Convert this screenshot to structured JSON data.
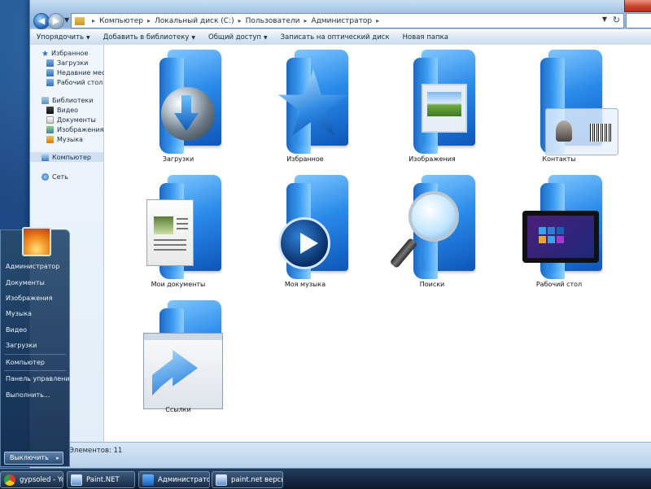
{
  "window": {
    "breadcrumbs": [
      "Компьютер",
      "Локальный диск (C:)",
      "Пользователи",
      "Администратор"
    ]
  },
  "toolbar": {
    "organize": "Упорядочить",
    "add_to_library": "Добавить в библиотеку",
    "share": "Общий доступ",
    "burn": "Записать на оптический диск",
    "new_folder": "Новая папка"
  },
  "navpane": {
    "favorites": "Избранное",
    "downloads": "Загрузки",
    "recent": "Недавние места",
    "desktop": "Рабочий стол",
    "libraries": "Библиотеки",
    "video": "Видео",
    "documents": "Документы",
    "images": "Изображения",
    "music": "Музыка",
    "computer": "Компьютер",
    "network": "Сеть"
  },
  "items": [
    {
      "label": "Загрузки",
      "icon": "download-globe-icon"
    },
    {
      "label": "Избранное",
      "icon": "star-icon"
    },
    {
      "label": "Изображения",
      "icon": "picture-icon"
    },
    {
      "label": "Контакты",
      "icon": "contact-card-icon"
    },
    {
      "label": "Мои документы",
      "icon": "document-icon"
    },
    {
      "label": "Моя музыка",
      "icon": "play-icon"
    },
    {
      "label": "Поиски",
      "icon": "magnifier-icon"
    },
    {
      "label": "Рабочий стол",
      "icon": "tablet-icon"
    },
    {
      "label": "Ссылки",
      "icon": "shortcut-arrow-icon"
    }
  ],
  "statusbar": {
    "text": "Элементов: 11"
  },
  "startmenu": {
    "items": [
      "Администратор",
      "Документы",
      "Изображения",
      "Музыка",
      "Видео",
      "Загрузки",
      "Компьютер",
      "Панель управления",
      "Выполнить..."
    ],
    "shutdown": "Выключить"
  },
  "taskbar": {
    "tasks": [
      {
        "label": "gypsoled - YouTu",
        "icon": "chrome-icon"
      },
      {
        "label": "Paint.NET",
        "icon": "paint-icon"
      },
      {
        "label": "Администратор",
        "icon": "explorer-icon"
      },
      {
        "label": "paint.net версия",
        "icon": "paint-icon"
      }
    ]
  },
  "colors": {
    "accent": "#2a8bea",
    "toolbar_bg": "#dbe8f4",
    "close": "#c7402a"
  }
}
